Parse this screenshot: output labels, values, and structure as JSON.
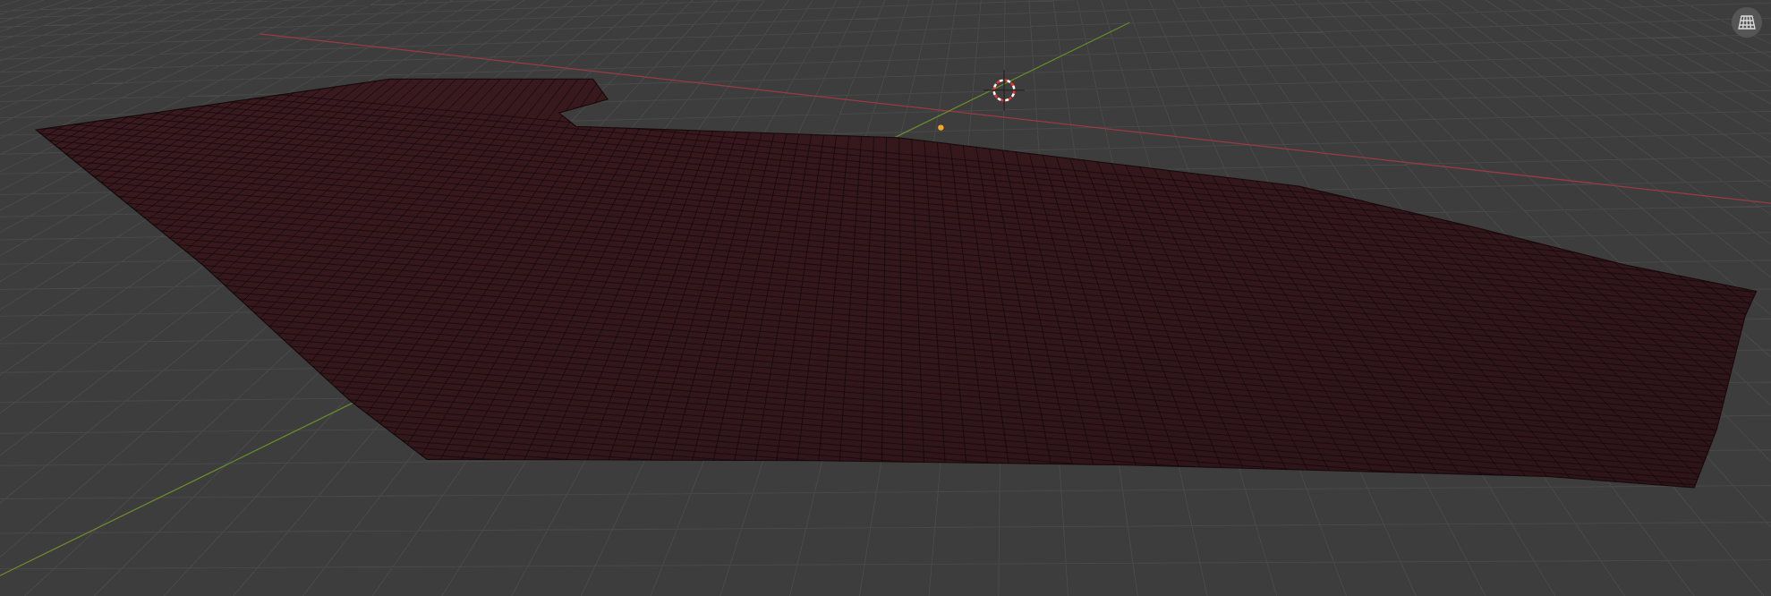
{
  "viewport": {
    "overlays": true
  }
}
